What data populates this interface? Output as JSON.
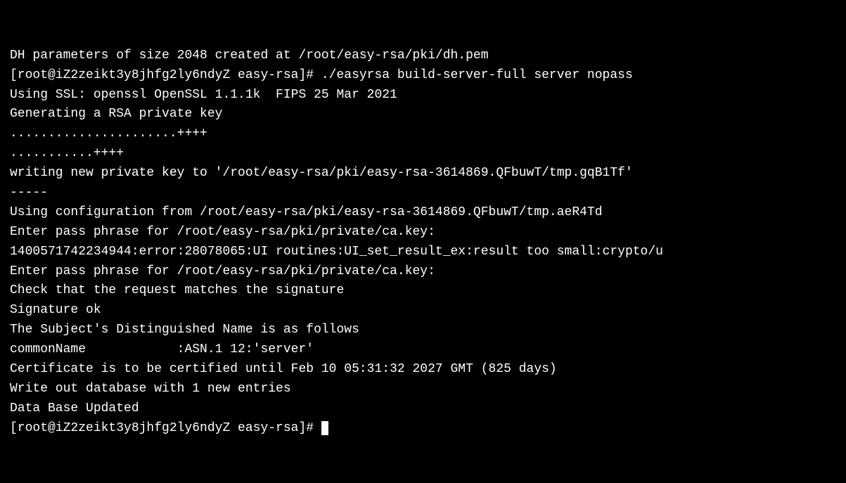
{
  "terminal": {
    "lines": [
      "DH parameters of size 2048 created at /root/easy-rsa/pki/dh.pem",
      "",
      "[root@iZ2zeikt3y8jhfg2ly6ndyZ easy-rsa]# ./easyrsa build-server-full server nopass",
      "Using SSL: openssl OpenSSL 1.1.1k  FIPS 25 Mar 2021",
      "Generating a RSA private key",
      "......................++++",
      "...........++++",
      "writing new private key to '/root/easy-rsa/pki/easy-rsa-3614869.QFbuwT/tmp.gqB1Tf'",
      "-----",
      "Using configuration from /root/easy-rsa/pki/easy-rsa-3614869.QFbuwT/tmp.aeR4Td",
      "Enter pass phrase for /root/easy-rsa/pki/private/ca.key:",
      "1400571742234944:error:28078065:UI routines:UI_set_result_ex:result too small:crypto/u",
      "Enter pass phrase for /root/easy-rsa/pki/private/ca.key:",
      "Check that the request matches the signature",
      "Signature ok",
      "The Subject's Distinguished Name is as follows",
      "commonName            :ASN.1 12:'server'",
      "Certificate is to be certified until Feb 10 05:31:32 2027 GMT (825 days)",
      "",
      "Write out database with 1 new entries",
      "Data Base Updated",
      "",
      "[root@iZ2zeikt3y8jhfg2ly6ndyZ easy-rsa]# "
    ],
    "prompt_prefix": "[root@iZ2zeikt3y8jhfg2ly6ndyZ easy-rsa]# "
  }
}
